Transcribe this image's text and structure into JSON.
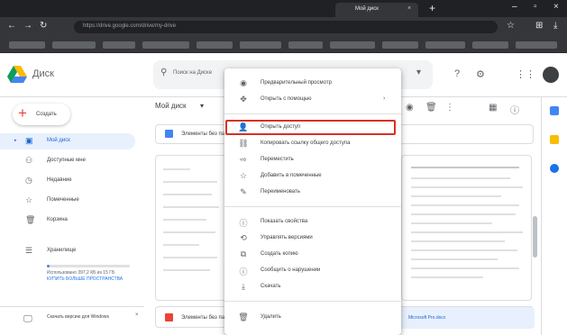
{
  "browser": {
    "active_tab_title": "Мой диск",
    "url": "https://drive.google.com/drive/my-drive"
  },
  "drive": {
    "brand": "Диск",
    "search_placeholder": "Поиск на Диске"
  },
  "sidebar": {
    "create_label": "Создать",
    "items": [
      {
        "label": "Мой диск",
        "icon": "my-drive-icon",
        "active": true
      },
      {
        "label": "Доступные мне",
        "icon": "shared-icon",
        "active": false
      },
      {
        "label": "Недавние",
        "icon": "clock-icon",
        "active": false
      },
      {
        "label": "Помеченные",
        "icon": "star-icon",
        "active": false
      },
      {
        "label": "Корзина",
        "icon": "trash-icon",
        "active": false
      },
      {
        "label": "Хранилище",
        "icon": "storage-icon",
        "active": false
      }
    ],
    "storage_text": "Использовано 397,2 КБ из 15 ГБ",
    "buy_storage": "КУПИТЬ БОЛЬШЕ ПРОСТРАНСТВА",
    "desktop_label": "Скачать версию для Windows"
  },
  "main": {
    "breadcrumb": "Мой диск",
    "folder_label": "Элементы без папки",
    "file_label": "Элементы без папки",
    "selected_file_label": "Microsoft Pro.docx"
  },
  "context_menu": {
    "items": [
      {
        "label": "Предварительный просмотр",
        "icon": "eye-icon"
      },
      {
        "label": "Открыть с помощью",
        "icon": "open-with-icon",
        "submenu": true
      },
      {
        "label": "Открыть доступ",
        "icon": "share-icon",
        "highlighted": true
      },
      {
        "label": "Копировать ссылку общего доступа",
        "icon": "link-icon"
      },
      {
        "label": "Переместить",
        "icon": "move-icon"
      },
      {
        "label": "Добавить в помеченные",
        "icon": "star-icon"
      },
      {
        "label": "Переименовать",
        "icon": "rename-icon"
      },
      {
        "label": "Показать свойства",
        "icon": "info-icon"
      },
      {
        "label": "Управлять версиями",
        "icon": "versions-icon"
      },
      {
        "label": "Создать копию",
        "icon": "copy-icon"
      },
      {
        "label": "Сообщить о нарушении",
        "icon": "report-icon"
      },
      {
        "label": "Скачать",
        "icon": "download-icon"
      },
      {
        "label": "Удалить",
        "icon": "trash-icon"
      }
    ]
  },
  "colors": {
    "highlight": "#d93025",
    "accent": "#1967d2"
  }
}
